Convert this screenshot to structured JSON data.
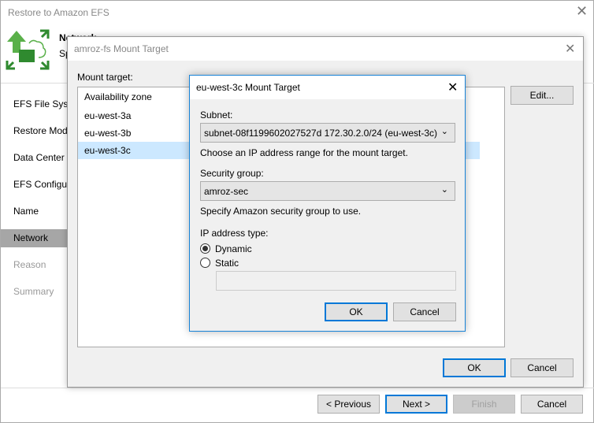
{
  "window": {
    "title": "Restore to Amazon EFS",
    "header_title": "Network",
    "header_subtitle": "Sp"
  },
  "sidebar": {
    "items": [
      {
        "label": "EFS File System",
        "state": "done"
      },
      {
        "label": "Restore Mode",
        "state": "done"
      },
      {
        "label": "Data Center",
        "state": "done"
      },
      {
        "label": "EFS Configuration",
        "state": "done"
      },
      {
        "label": "Name",
        "state": "done"
      },
      {
        "label": "Network",
        "state": "selected"
      },
      {
        "label": "Reason",
        "state": "disabled"
      },
      {
        "label": "Summary",
        "state": "disabled"
      }
    ]
  },
  "footer": {
    "previous": "< Previous",
    "next": "Next >",
    "finish": "Finish",
    "cancel": "Cancel"
  },
  "mount_dialog": {
    "title": "amroz-fs Mount Target",
    "label": "Mount target:",
    "column": "Availability zone",
    "rows": [
      "eu-west-3a",
      "eu-west-3b",
      "eu-west-3c"
    ],
    "selected": 2,
    "edit": "Edit...",
    "ok": "OK",
    "cancel": "Cancel"
  },
  "inner_dialog": {
    "title": "eu-west-3c Mount Target",
    "subnet_label": "Subnet:",
    "subnet_value": "subnet-08f1199602027527d 172.30.2.0/24 (eu-west-3c)",
    "subnet_help": "Choose an IP address range for the mount target.",
    "sg_label": "Security group:",
    "sg_value": "amroz-sec",
    "sg_help": "Specify Amazon security group to use.",
    "ip_label": "IP address type:",
    "dynamic": "Dynamic",
    "static": "Static",
    "static_value": "",
    "selected_ip_type": "Dynamic",
    "ok": "OK",
    "cancel": "Cancel"
  }
}
